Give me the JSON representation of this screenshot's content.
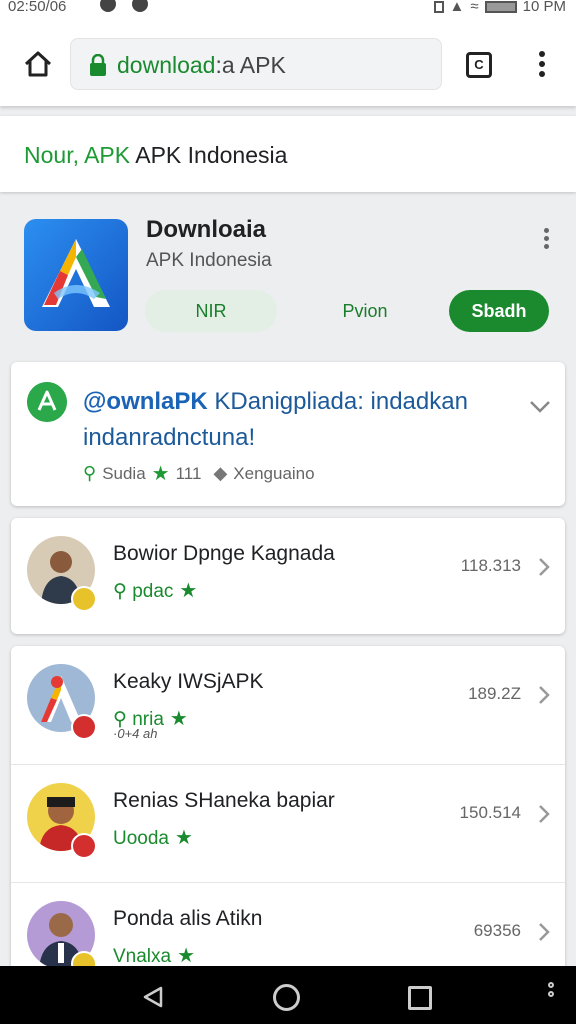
{
  "status_bar": {
    "time": "02:50/06",
    "clock": "10 PM"
  },
  "browser": {
    "url_primary": "download",
    "url_rest": ":a APK",
    "tabs_count": "C"
  },
  "site": {
    "title_green": "Nour, APK",
    "title_black": " APK Indonesia"
  },
  "app": {
    "name": "Downloaia",
    "subtitle": "APK Indonesia",
    "buttons": {
      "nir": "NIR",
      "pvion": "Pvion",
      "sbadh": "Sbadh"
    }
  },
  "promo": {
    "title_lead": "@ownlaPK",
    "title_rest": " KDanigpliada: indadkan indanradnctuna!",
    "meta": {
      "source": "Sudia",
      "rating": "111",
      "language": "Xenguaino"
    }
  },
  "list_items": [
    {
      "title": "Bowior Dpnge Kagnada",
      "subtitle": "pdac",
      "extra": "",
      "count": "118.313",
      "badge": "yellow"
    },
    {
      "title": "Keaky IWSjAPK",
      "subtitle": "nria",
      "extra": "·0+4 ah",
      "count": "189.2Z",
      "badge": "red"
    },
    {
      "title": "Renias SHaneka bapiar",
      "subtitle": "Uooda",
      "extra": "",
      "count": "150.514",
      "badge": "red"
    },
    {
      "title": "Ponda alis Atikn",
      "subtitle": "Vnalxa",
      "extra": "",
      "count": "69356",
      "badge": "yellow"
    }
  ],
  "colors": {
    "accent_green": "#1b8a2e",
    "link_blue": "#1a63b5",
    "badge_red": "#d32f2f",
    "badge_yellow": "#e8c22b"
  }
}
